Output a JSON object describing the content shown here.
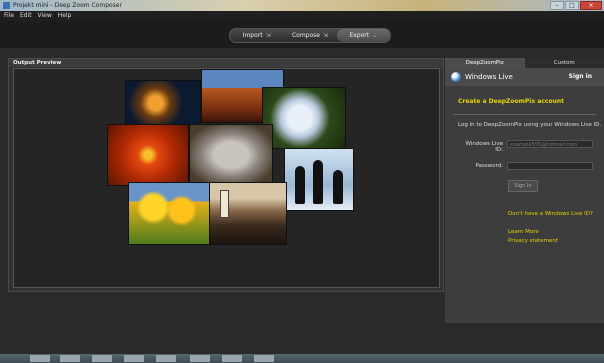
{
  "window": {
    "title": "Projekt mini - Deep Zoom Composer"
  },
  "menu": [
    "File",
    "Edit",
    "View",
    "Help"
  ],
  "modes": {
    "import": "Import",
    "compose": "Compose",
    "export": "Export"
  },
  "preview": {
    "header": "Output Preview"
  },
  "tabs": [
    "DeepZoomPix",
    "Custom"
  ],
  "windows_live": {
    "brand": "Windows Live",
    "sign_in": "Sign in",
    "create_account": "Create a DeepZoomPix account",
    "login_desc": "Log in to DeepZoomPix using your Windows Live ID.",
    "id_label": "Windows Live ID:",
    "id_placeholder": "example555@hotmail.com",
    "password_label": "Password:",
    "sign_in_button": "Sign In",
    "no_id_link": "Don't have a Windows Live ID?",
    "learn_more": "Learn More",
    "privacy": "Privacy statement"
  },
  "colors": {
    "link": "#e6d200",
    "panel": "#3d3d3d",
    "background": "#2a2a2a"
  }
}
